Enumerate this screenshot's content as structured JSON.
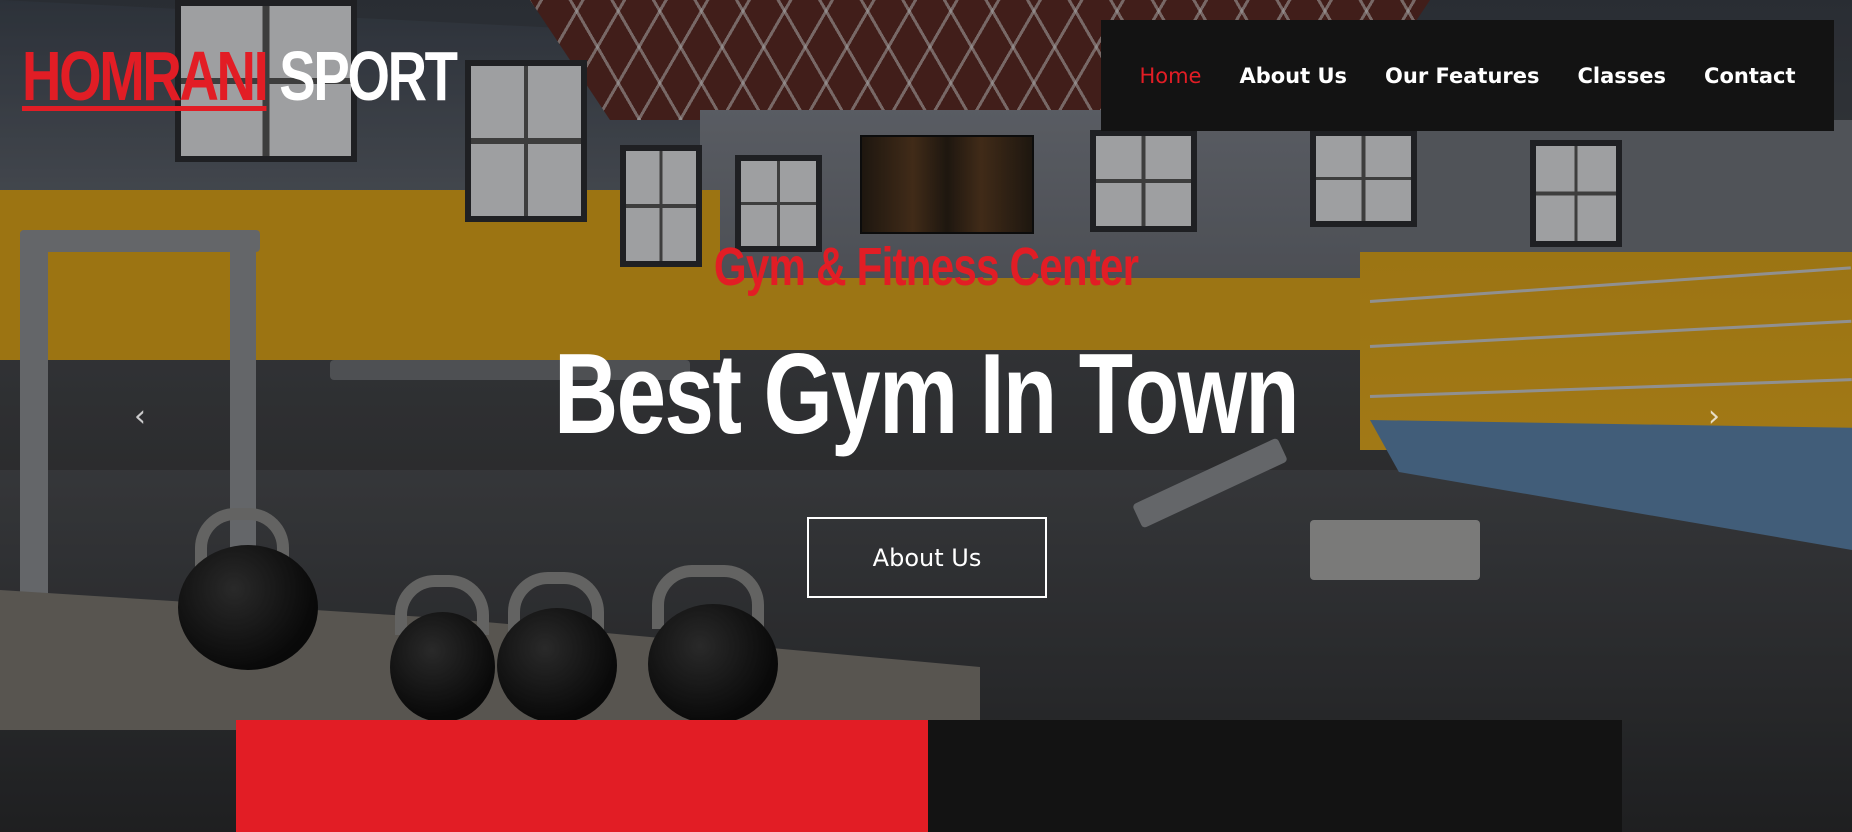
{
  "brand": {
    "name_part1": "HOMRANI",
    "name_part2": "SPORT",
    "accent_color": "#e21d25"
  },
  "nav": {
    "items": [
      {
        "label": "Home",
        "active": true
      },
      {
        "label": "About Us",
        "active": false
      },
      {
        "label": "Our Features",
        "active": false
      },
      {
        "label": "Classes",
        "active": false
      },
      {
        "label": "Contact",
        "active": false
      }
    ]
  },
  "hero": {
    "subtitle": "Gym & Fitness Center",
    "headline": "Best Gym In Town",
    "cta_label": "About Us",
    "prev_icon": "chevron-left-icon",
    "next_icon": "chevron-right-icon",
    "prev_glyph": "‹",
    "next_glyph": "›"
  }
}
